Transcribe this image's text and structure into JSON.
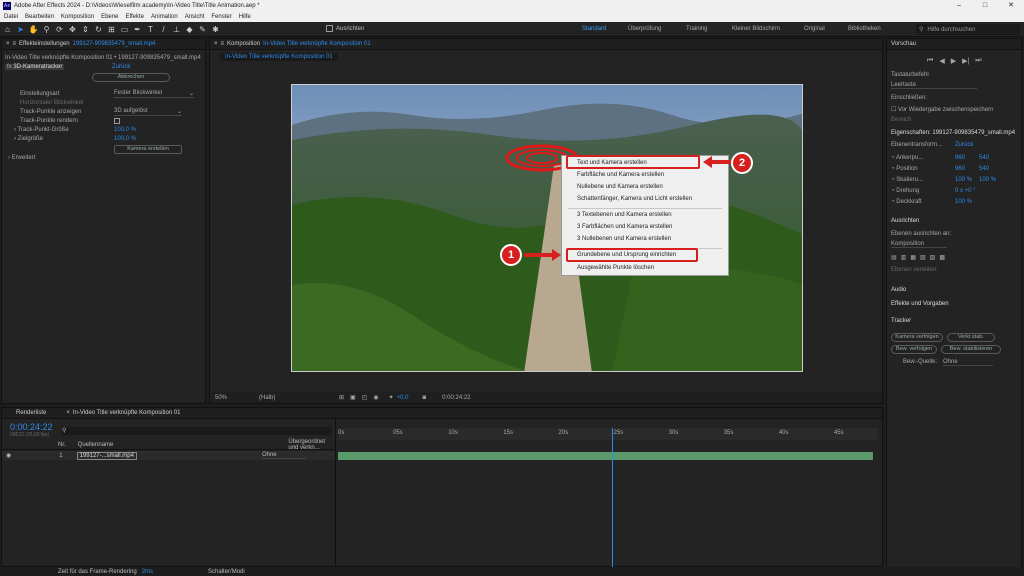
{
  "app": {
    "title": "Adobe After Effects 2024 - D:\\Videos\\Wieselfilm academy\\In-Video Title\\Title Animation.aep *"
  },
  "menus": [
    "Datei",
    "Bearbeiten",
    "Komposition",
    "Ebene",
    "Effekte",
    "Animation",
    "Ansicht",
    "Fenster",
    "Hilfe"
  ],
  "toolbar": {
    "align_label": "Ausrichten",
    "workspaces": [
      "Standard",
      "Überprüfung",
      "Training",
      "Kleiner Bildschirm",
      "Original",
      "Bibliotheken"
    ],
    "active_workspace": "Standard",
    "search_placeholder": "Hilfe durchsuchen"
  },
  "effects_panel": {
    "tab": "Effekteinstellungen",
    "tab_file": "199127-909835479_small.mp4",
    "breadcrumb": "In-Video Title verknüpfte Komposition 01 • 199127-909835479_small.mp4",
    "fx_name": "3D-Kameratracker",
    "fx_reset": "Zurück",
    "analyze_label": "Abbrechen",
    "rows": [
      {
        "label": "Einstellungsart",
        "value": "Fester Blickwinkel"
      },
      {
        "label": "Track-Punkte anzeigen",
        "value": "3D aufgelöst"
      },
      {
        "label": "Track-Punkte rendern",
        "value": ""
      },
      {
        "label": "Track-Punkt-Größe",
        "value": "100,0 %"
      },
      {
        "label": "Zielgröße",
        "value": "100,0 %"
      }
    ],
    "dim_row": "Horizontaler Blickwinkel",
    "create_camera": "Kamera erstellen",
    "advanced": "Erweitert"
  },
  "comp_panel": {
    "tab": "Komposition",
    "tab_name": "In-Video Title verknüpfte Komposition 01",
    "subtab": "In-Video Title verknüpfte Komposition 01",
    "zoom": "50%",
    "quality": "(Halb)",
    "exposure": "+0,0",
    "timecode": "0:00:24:22"
  },
  "context_menu": {
    "items": [
      "Text und Kamera erstellen",
      "Farbfläche und Kamera erstellen",
      "Nullebene und Kamera erstellen",
      "Schattenfänger, Kamera und Licht erstellen",
      "3 Textebenen und Kamera erstellen",
      "3 Farbflächen und Kamera erstellen",
      "3 Nullebenen und Kamera erstellen",
      "Grundebene und Ursprung einrichten",
      "Ausgewählte Punkte löschen"
    ]
  },
  "annotations": {
    "badge1": "1",
    "badge2": "2",
    "color": "#d62020"
  },
  "right_panel": {
    "preview": "Vorschau",
    "shortcut_label": "Tastaturbefehl",
    "shortcut_value": "Leertaste",
    "include_label": "Einschließen:",
    "loop_label": "Vor Wiedergabe zwischenspeichern",
    "range_label": "Bereich",
    "properties": "Eigenschaften: 199127-909835479_small.mp4",
    "layer_transform": "Ebenentransform...",
    "reset": "Zurück",
    "props": [
      {
        "label": "Ankerpu...",
        "v1": "960",
        "v2": "540"
      },
      {
        "label": "Position",
        "v1": "960",
        "v2": "540"
      },
      {
        "label": "Skalieru...",
        "v1": "100 %",
        "v2": "100 %"
      },
      {
        "label": "Drehung",
        "v1": "0 x +0 °",
        "v2": ""
      },
      {
        "label": "Deckkraft",
        "v1": "100 %",
        "v2": ""
      }
    ],
    "align": "Ausrichten",
    "align_to": "Ebenen ausrichten an:",
    "align_target": "Komposition",
    "distribute": "Ebenen verteilen:",
    "audio": "Audio",
    "effects_presets": "Effekte und Vorgaben",
    "tracker": "Tracker",
    "tracker_buttons": [
      "Kamera verfolgen",
      "Verkr.stab.",
      "Bew. verfolgen",
      "Bew. stabilisieren"
    ],
    "motion_source_label": "Bew.-Quelle:",
    "motion_source": "Ohne"
  },
  "timeline": {
    "render_tab": "Renderliste",
    "comp_tab": "In-Video Title verknüpfte Komposition 01",
    "timecode": "0:00:24:22",
    "frame_info": "00622 (25,00 fps)",
    "col_nr": "Nr.",
    "col_source": "Quellenname",
    "col_parent": "Übergeordnet und verkn...",
    "layer_num": "1",
    "layer_name": "199127-...small.mp4",
    "layer_parent": "Ohne",
    "ruler": [
      "0s",
      "05s",
      "10s",
      "15s",
      "20s",
      "25s",
      "30s",
      "35s",
      "40s",
      "45s"
    ],
    "playhead_seconds": 24.9,
    "duration_seconds": 49
  },
  "statusbar": {
    "render_label": "Zeit für das Frame-Rendering",
    "render_value": "2ms",
    "mode": "Schalter/Modi"
  }
}
